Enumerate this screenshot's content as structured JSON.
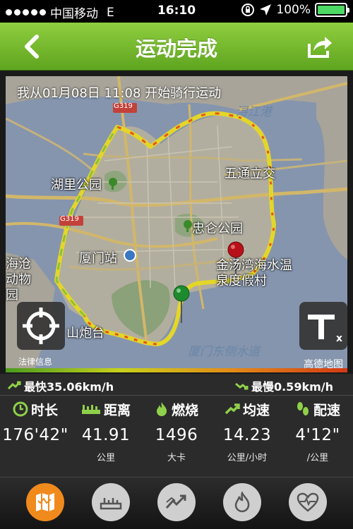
{
  "status_bar": {
    "carrier": "中国移动",
    "network": "E",
    "time": "16:10",
    "battery": "100%"
  },
  "header": {
    "title": "运动完成"
  },
  "map": {
    "caption": "我从01月08日 11:08 开始骑行运动",
    "labels": {
      "huli_park": "湖里公园",
      "xiamen_station": "厦门站",
      "zhonglun_park": "忠仑公园",
      "wutong": "五通立交",
      "yundang_port": "浔江港",
      "zoo": "海沧动物园",
      "hot_spring": "金汤湾海水温泉度假村",
      "paotai": "山炮台",
      "east_channel": "厦门东侧水道",
      "road_sign_1": "G319",
      "road_sign_2": "G319"
    },
    "legal": "法律信息",
    "provider": "高德地图"
  },
  "speed": {
    "fastest": "最快35.06km/h",
    "slowest": "最慢0.59km/h"
  },
  "stats": [
    {
      "label": "时长",
      "value": "176'42\"",
      "unit": ""
    },
    {
      "label": "距离",
      "value": "41.91",
      "unit": "公里"
    },
    {
      "label": "燃烧",
      "value": "1496",
      "unit": "大卡"
    },
    {
      "label": "均速",
      "value": "14.23",
      "unit": "公里/小时"
    },
    {
      "label": "配速",
      "value": "4'12\"",
      "unit": "/公里"
    }
  ],
  "colors": {
    "accent_green": "#7cc233",
    "tab_active": "#f08a1c",
    "stat_icon": "#8fd04a"
  },
  "tabs": [
    "map-tab",
    "ruler-tab",
    "speed-tab",
    "calorie-tab",
    "heart-tab"
  ]
}
